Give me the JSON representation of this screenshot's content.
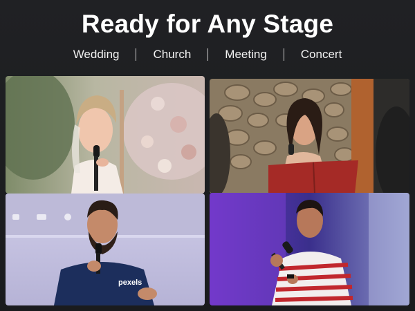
{
  "header": {
    "title": "Ready for Any Stage",
    "tags": [
      "Wedding",
      "Church",
      "Meeting",
      "Concert"
    ]
  },
  "photos": [
    {
      "icon": "wedding-singer-photo"
    },
    {
      "icon": "church-reader-photo"
    },
    {
      "icon": "meeting-speaker-photo"
    },
    {
      "icon": "concert-singer-photo"
    }
  ],
  "meeting_shirt_logo": "pexels",
  "colors": {
    "background": "#1e1f22",
    "text": "#ffffff",
    "separator": "#cfcfcf",
    "concert_light": "#7a3fd1"
  }
}
